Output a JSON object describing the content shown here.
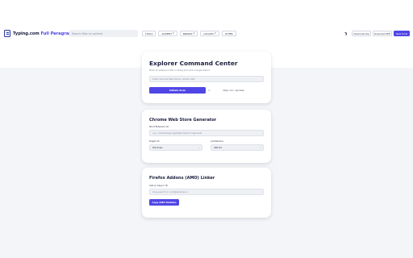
{
  "header": {
    "site_name": "Typing.com",
    "page_title": "Full Paragraph C...",
    "search_placeholder": "Search files or content",
    "nav": [
      {
        "label": "TOOLS",
        "dropdown": false
      },
      {
        "label": "AUDIENT",
        "dropdown": true
      },
      {
        "label": "BRANDS",
        "dropdown": true
      },
      {
        "label": "LOCALES",
        "dropdown": true
      },
      {
        "label": "OTHER",
        "dropdown": false
      }
    ],
    "theme_icon": "moon-icon",
    "download_zip_label": "Download Zip",
    "download_pdf_label": "Download PDF",
    "new_label": "New Tools"
  },
  "explorer": {
    "title": "Explorer Command Center",
    "subtitle": "Enter an extension URL or fixing and click a single wizard.",
    "input_placeholder": "Enter Chrome Web Store / Addon URL",
    "initiate_label": "Initiate Scan",
    "or_label": "or",
    "drop_label": "Drop .crx / .xpi here"
  },
  "chrome": {
    "title": "Chrome Web Store Generator",
    "id_label": "Short Extension ID",
    "id_placeholder": "e.g. nmmhkkegccagdldgiimedpiccmgmieda",
    "target_label": "Target UX",
    "target_value": "Windows",
    "architecture_label": "Architecture",
    "architecture_value": "x86-64"
  },
  "firefox": {
    "title": "Firefox Addons (AMO) Linker",
    "addon_label": "Add-on Slug or ID",
    "addon_placeholder": "bing-search or uuid@extension",
    "copy_label": "Copy AMO Relative"
  },
  "colors": {
    "accent": "#5046e5",
    "text": "#1b1e3d",
    "background": "#f4f5f8"
  }
}
